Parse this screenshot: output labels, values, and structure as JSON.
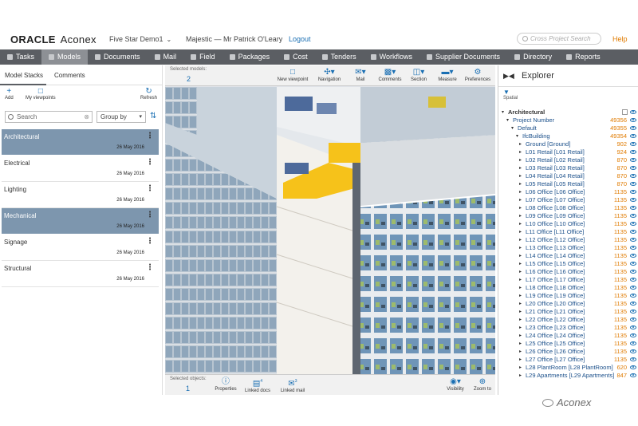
{
  "header": {
    "brand": "ORACLE",
    "product": "Aconex",
    "project": "Five Star Demo1",
    "org": "Majestic",
    "separator": "—",
    "user": "Mr Patrick O'Leary",
    "logout": "Logout",
    "search_placeholder": "Cross Project Search",
    "help": "Help"
  },
  "nav": {
    "items": [
      {
        "label": "Tasks",
        "icon": "check-icon"
      },
      {
        "label": "Models",
        "icon": "cube-icon",
        "active": true
      },
      {
        "label": "Documents",
        "icon": "document-icon"
      },
      {
        "label": "Mail",
        "icon": "mail-icon"
      },
      {
        "label": "Field",
        "icon": "field-icon"
      },
      {
        "label": "Packages",
        "icon": "package-icon"
      },
      {
        "label": "Cost",
        "icon": "cost-icon"
      },
      {
        "label": "Tenders",
        "icon": "tender-icon"
      },
      {
        "label": "Workflows",
        "icon": "workflow-icon"
      },
      {
        "label": "Supplier Documents",
        "icon": "supplier-icon"
      },
      {
        "label": "Directory",
        "icon": "directory-icon"
      },
      {
        "label": "Reports",
        "icon": "report-icon"
      }
    ]
  },
  "left_panel": {
    "tabs": [
      "Model Stacks",
      "Comments"
    ],
    "tools": {
      "add": "Add",
      "my_viewpoints": "My viewpoints",
      "refresh": "Refresh"
    },
    "search_value": "Search",
    "group_by": "Group by",
    "stacks": [
      {
        "name": "Architectural",
        "date": "26 May 2016",
        "selected": true
      },
      {
        "name": "Electrical",
        "date": "26 May 2016",
        "selected": false
      },
      {
        "name": "Lighting",
        "date": "26 May 2016",
        "selected": false
      },
      {
        "name": "Mechanical",
        "date": "26 May 2016",
        "selected": true
      },
      {
        "name": "Signage",
        "date": "26 May 2016",
        "selected": false
      },
      {
        "name": "Structural",
        "date": "26 May 2016",
        "selected": false
      }
    ]
  },
  "viewer": {
    "selected_models_label": "Selected models:",
    "selected_models_count": "2",
    "toolbar": [
      "New viewpoint",
      "Navigation",
      "Mail",
      "Comments",
      "Section",
      "Measure",
      "Preferences"
    ],
    "selected_objects_label": "Selected objects:",
    "selected_objects_count": "1",
    "bottom_tools": [
      "Properties",
      "Linked docs",
      "Linked mail"
    ],
    "right_tools": [
      "Visibility",
      "Zoom to"
    ],
    "linked_docs_badge": "4",
    "linked_mail_badge": "3"
  },
  "explorer": {
    "title": "Explorer",
    "filter_label": "Spatial",
    "tree": [
      {
        "label": "Architectural",
        "count": "",
        "level": 0,
        "root": true
      },
      {
        "label": "Project Number",
        "count": "49356",
        "level": 1
      },
      {
        "label": "Default",
        "count": "49355",
        "level": 2
      },
      {
        "label": "IfcBuilding",
        "count": "49354",
        "level": 3
      },
      {
        "label": "Ground [Ground]",
        "count": "902",
        "level": 4
      },
      {
        "label": "L01 Retail [L01 Retail]",
        "count": "924",
        "level": 4
      },
      {
        "label": "L02 Retail [L02 Retail]",
        "count": "870",
        "level": 4
      },
      {
        "label": "L03 Retail [L03 Retail]",
        "count": "870",
        "level": 4
      },
      {
        "label": "L04 Retail [L04 Retail]",
        "count": "870",
        "level": 4
      },
      {
        "label": "L05 Retail [L05 Retail]",
        "count": "870",
        "level": 4
      },
      {
        "label": "L06 Office [L06 Office]",
        "count": "1135",
        "level": 4
      },
      {
        "label": "L07 Office [L07 Office]",
        "count": "1135",
        "level": 4
      },
      {
        "label": "L08 Office [L08 Office]",
        "count": "1135",
        "level": 4
      },
      {
        "label": "L09 Office [L09 Office]",
        "count": "1135",
        "level": 4
      },
      {
        "label": "L10 Office [L10 Office]",
        "count": "1135",
        "level": 4
      },
      {
        "label": "L11 Office [L11 Office]",
        "count": "1135",
        "level": 4
      },
      {
        "label": "L12 Office [L12 Office]",
        "count": "1135",
        "level": 4
      },
      {
        "label": "L13 Office [L13 Office]",
        "count": "1135",
        "level": 4
      },
      {
        "label": "L14 Office [L14 Office]",
        "count": "1135",
        "level": 4
      },
      {
        "label": "L15 Office [L15 Office]",
        "count": "1135",
        "level": 4
      },
      {
        "label": "L16 Office [L16 Office]",
        "count": "1135",
        "level": 4
      },
      {
        "label": "L17 Office [L17 Office]",
        "count": "1135",
        "level": 4
      },
      {
        "label": "L18 Office [L18 Office]",
        "count": "1135",
        "level": 4
      },
      {
        "label": "L19 Office [L19 Office]",
        "count": "1135",
        "level": 4
      },
      {
        "label": "L20 Office [L20 Office]",
        "count": "1135",
        "level": 4
      },
      {
        "label": "L21 Office [L21 Office]",
        "count": "1135",
        "level": 4
      },
      {
        "label": "L22 Office [L22 Office]",
        "count": "1135",
        "level": 4
      },
      {
        "label": "L23 Office [L23 Office]",
        "count": "1135",
        "level": 4
      },
      {
        "label": "L24 Office [L24 Office]",
        "count": "1135",
        "level": 4
      },
      {
        "label": "L25 Office [L25 Office]",
        "count": "1135",
        "level": 4
      },
      {
        "label": "L26 Office [L26 Office]",
        "count": "1135",
        "level": 4
      },
      {
        "label": "L27 Office [L27 Office]",
        "count": "1135",
        "level": 4
      },
      {
        "label": "L28 PlantRoom [L28 PlantRoom]",
        "count": "620",
        "level": 4
      },
      {
        "label": "L29 Apartments [L29 Apartments]",
        "count": "847",
        "level": 4
      }
    ]
  },
  "watermark": "Aconex",
  "colors": {
    "nav_bg": "#5b5e63",
    "nav_active": "#8d9095",
    "selected_row": "#7d96ae",
    "accent_blue": "#1a6fb3",
    "count_orange": "#e07b00",
    "highlight_yellow": "#f6c21a"
  }
}
